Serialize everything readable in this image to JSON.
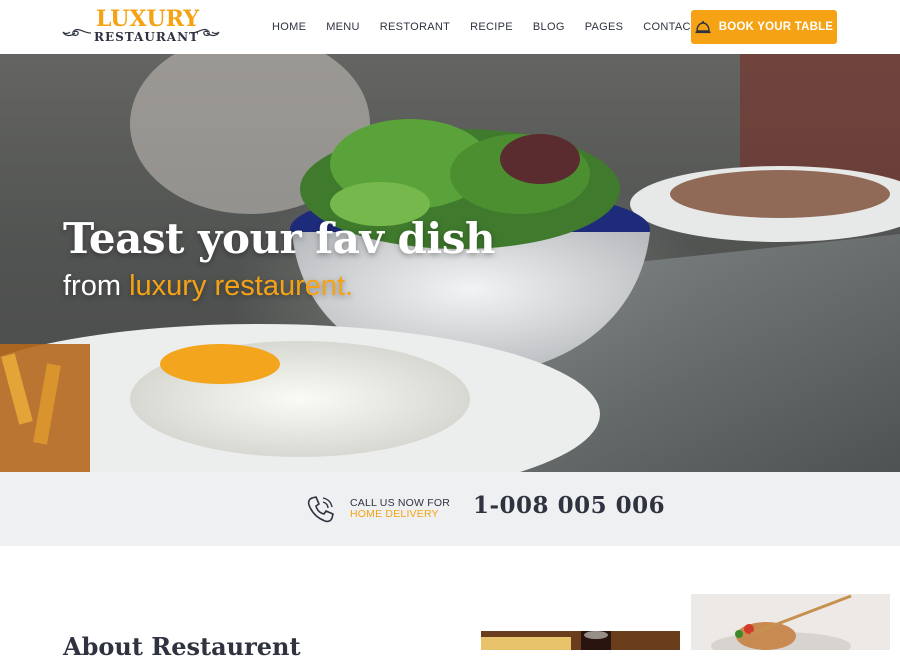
{
  "brand": {
    "logo_top": "LUXURY",
    "logo_bottom": "RESTAURANT"
  },
  "nav": {
    "items": [
      "HOME",
      "MENU",
      "RESTORANT",
      "RECIPE",
      "BLOG",
      "PAGES",
      "CONTACT"
    ]
  },
  "cta": {
    "label": "BOOK YOUR TABLE",
    "icon": "cloche-icon"
  },
  "hero": {
    "title": "Teast your fav dish",
    "subtitle_prefix": "from",
    "subtitle_accent": "luxury restaurent."
  },
  "callbar": {
    "line1": "CALL US NOW FOR",
    "line2": "HOME DELIVERY",
    "phone": "1-008 005 006",
    "icon": "phone-icon"
  },
  "about": {
    "title": "About Restaurent"
  },
  "colors": {
    "accent": "#f5a314",
    "text_dark": "#2f3340",
    "callbar_bg": "#eef0f2"
  }
}
